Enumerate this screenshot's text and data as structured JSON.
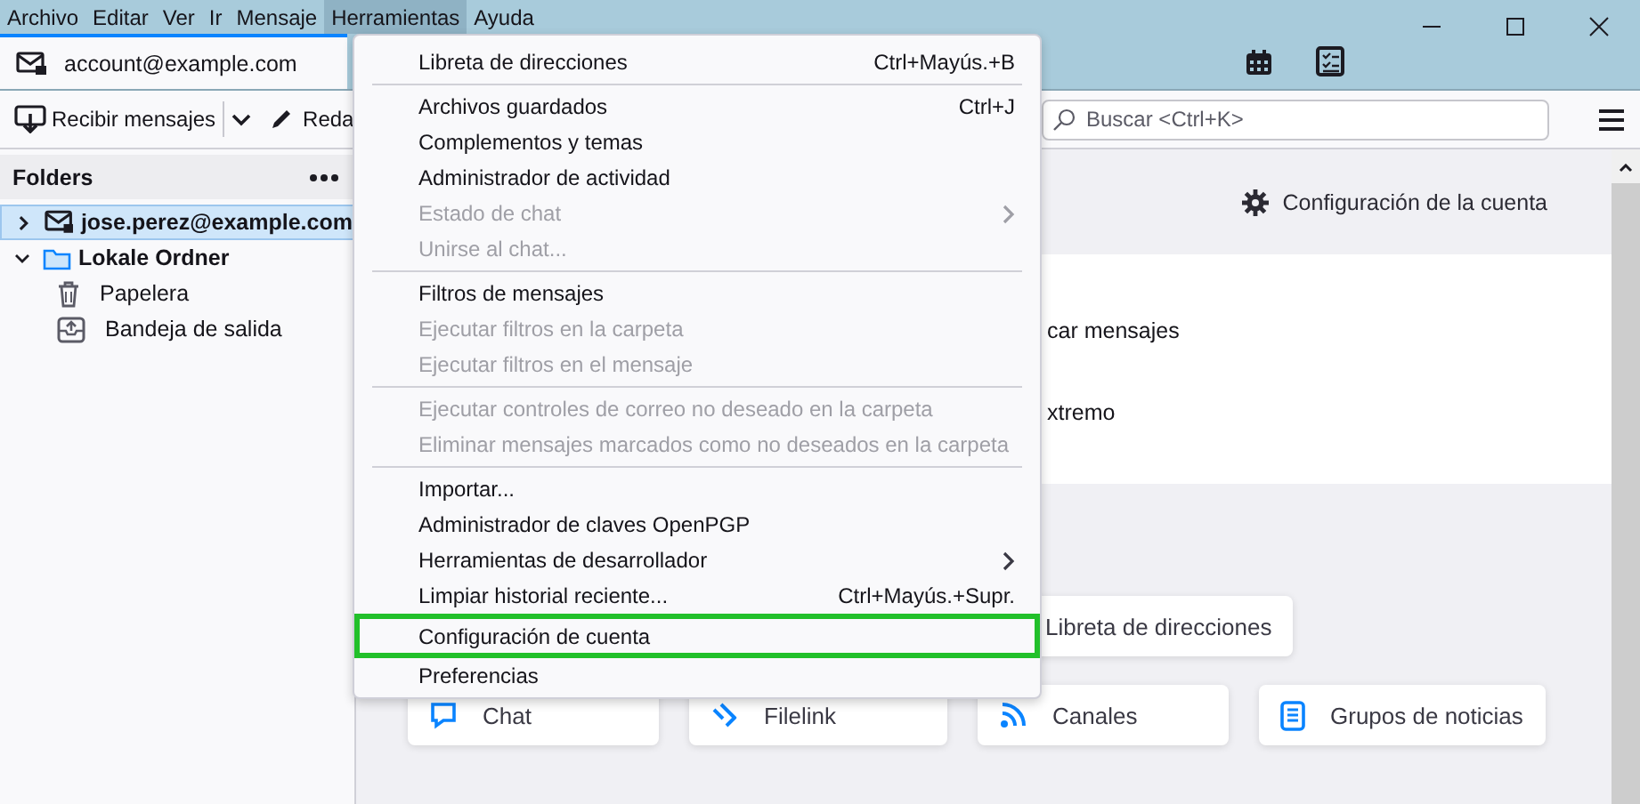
{
  "menubar": [
    {
      "label": "Archivo",
      "selected": false
    },
    {
      "label": "Editar",
      "selected": false
    },
    {
      "label": "Ver",
      "selected": false
    },
    {
      "label": "Ir",
      "selected": false
    },
    {
      "label": "Mensaje",
      "selected": false
    },
    {
      "label": "Herramientas",
      "selected": true
    },
    {
      "label": "Ayuda",
      "selected": false
    }
  ],
  "account_tab": {
    "label": "account@example.com"
  },
  "toolbar": {
    "get_messages": "Recibir mensajes",
    "write": "Reda",
    "search": {
      "placeholder": "Buscar <Ctrl+K>"
    }
  },
  "folder_pane": {
    "title": "Folders",
    "folders": [
      {
        "name": "jose.perez@example.com",
        "kind": "account",
        "expanded": false,
        "selected": true
      },
      {
        "name": "Lokale Ordner",
        "kind": "local",
        "expanded": true,
        "selected": false,
        "children": [
          {
            "name": "Papelera",
            "kind": "trash",
            "selected": false
          },
          {
            "name": "Bandeja de salida",
            "kind": "outbox",
            "selected": false
          }
        ]
      }
    ]
  },
  "account_header": {
    "settings_link": "Configuración de la cuenta"
  },
  "account_options": [
    "car mensajes",
    "xtremo"
  ],
  "setup_buttons": [
    {
      "label": "Libreta de direcciones",
      "kind": "addressbook"
    }
  ],
  "feature_buttons": [
    {
      "label": "Chat",
      "kind": "chat"
    },
    {
      "label": "Filelink",
      "kind": "filelink"
    },
    {
      "label": "Canales",
      "kind": "feeds"
    },
    {
      "label": "Grupos de noticias",
      "kind": "newsgroups"
    }
  ],
  "menu": {
    "items": [
      {
        "kind": "item",
        "label": "Libreta de direcciones",
        "shortcut": "Ctrl+Mayús.+B",
        "disabled": false,
        "submenu": false,
        "highlighted": false
      },
      {
        "kind": "separator"
      },
      {
        "kind": "item",
        "label": "Archivos guardados",
        "shortcut": "Ctrl+J",
        "disabled": false,
        "submenu": false,
        "highlighted": false
      },
      {
        "kind": "item",
        "label": "Complementos y temas",
        "disabled": false,
        "submenu": false,
        "highlighted": false
      },
      {
        "kind": "item",
        "label": "Administrador de actividad",
        "disabled": false,
        "submenu": false,
        "highlighted": false
      },
      {
        "kind": "item",
        "label": "Estado de chat",
        "disabled": true,
        "submenu": true,
        "highlighted": false
      },
      {
        "kind": "item",
        "label": "Unirse al chat...",
        "disabled": true,
        "submenu": false,
        "highlighted": false
      },
      {
        "kind": "separator"
      },
      {
        "kind": "item",
        "label": "Filtros de mensajes",
        "disabled": false,
        "submenu": false,
        "highlighted": false
      },
      {
        "kind": "item",
        "label": "Ejecutar filtros en la carpeta",
        "disabled": true,
        "submenu": false,
        "highlighted": false
      },
      {
        "kind": "item",
        "label": "Ejecutar filtros en el mensaje",
        "disabled": true,
        "submenu": false,
        "highlighted": false
      },
      {
        "kind": "separator"
      },
      {
        "kind": "item",
        "label": "Ejecutar controles de correo no deseado en la carpeta",
        "disabled": true,
        "submenu": false,
        "highlighted": false
      },
      {
        "kind": "item",
        "label": "Eliminar mensajes marcados como no deseados en la carpeta",
        "disabled": true,
        "submenu": false,
        "highlighted": false
      },
      {
        "kind": "separator"
      },
      {
        "kind": "item",
        "label": "Importar...",
        "disabled": false,
        "submenu": false,
        "highlighted": false
      },
      {
        "kind": "item",
        "label": "Administrador de claves OpenPGP",
        "disabled": false,
        "submenu": false,
        "highlighted": false
      },
      {
        "kind": "item",
        "label": "Herramientas de desarrollador",
        "disabled": false,
        "submenu": true,
        "highlighted": false
      },
      {
        "kind": "item",
        "label": "Limpiar historial reciente...",
        "shortcut": "Ctrl+Mayús.+Supr.",
        "disabled": false,
        "submenu": false,
        "highlighted": false
      },
      {
        "kind": "item",
        "label": "Configuración de cuenta",
        "disabled": false,
        "submenu": false,
        "highlighted": true
      },
      {
        "kind": "item",
        "label": "Preferencias",
        "disabled": false,
        "submenu": false,
        "highlighted": false
      }
    ]
  }
}
